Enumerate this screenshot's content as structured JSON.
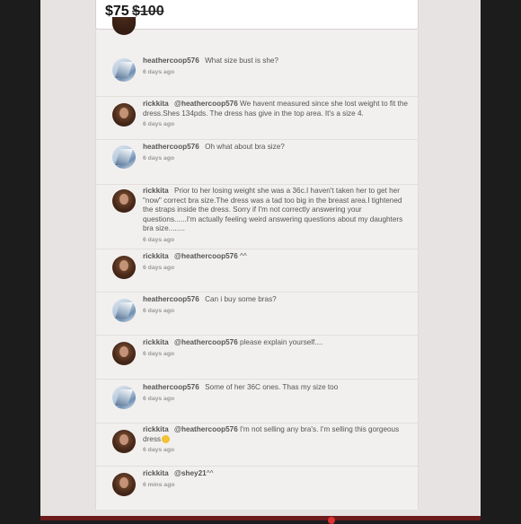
{
  "listing": {
    "price": "$75",
    "original_price": "$100"
  },
  "comments": [
    {
      "user": "heathercoop576",
      "mention": "",
      "text": "What size bust is she?",
      "time": "6 days ago"
    },
    {
      "user": "rickkita",
      "mention": "@heathercoop576",
      "text": "We havent measured since she lost weight to fit the dress.Shes 134pds. The dress has give in the top area. It's a size 4.",
      "time": "6 days ago"
    },
    {
      "user": "heathercoop576",
      "mention": "",
      "text": "Oh what about bra size?",
      "time": "6 days ago"
    },
    {
      "user": "rickkita",
      "mention": "",
      "text": "Prior to her losing weight she was a 36c.I haven't taken her to get her \"now\" correct bra size.The dress was a tad too big in the breast area.I tightened the straps inside the dress. Sorry if I'm not correctly answering your questions......I'm actually feeling weird answering questions about my daughters bra size........",
      "time": "6 days ago"
    },
    {
      "user": "rickkita",
      "mention": "@heathercoop576",
      "text": "^^",
      "time": "6 days ago"
    },
    {
      "user": "heathercoop576",
      "mention": "",
      "text": "Can i buy some bras?",
      "time": "6 days ago"
    },
    {
      "user": "rickkita",
      "mention": "@heathercoop576",
      "text": "please explain yourself....",
      "time": "6 days ago"
    },
    {
      "user": "heathercoop576",
      "mention": "",
      "text": "Some of her 36C ones. Thas my size too",
      "time": "6 days ago"
    },
    {
      "user": "rickkita",
      "mention": "@heathercoop576",
      "text": "I'm not selling any bra's. I'm selling this gorgeous dress",
      "time": "6 days ago"
    },
    {
      "user": "rickkita",
      "mention": "@shey21",
      "text": "^^",
      "time": "6 mins ago"
    }
  ],
  "icons": {
    "emoji": "grimacing-emoji-icon"
  }
}
